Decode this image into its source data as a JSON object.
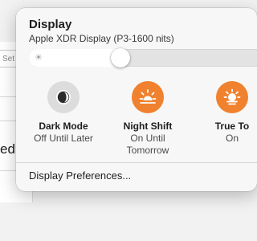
{
  "background": {
    "field_text": "Set S",
    "side_text": "ed"
  },
  "panel": {
    "title": "Display",
    "subtitle": "Apple XDR Display (P3-1600 nits)",
    "brightness": {
      "icon": "sun-icon",
      "level": 0.38
    },
    "tiles": [
      {
        "label": "Dark Mode",
        "status": "Off Until Later",
        "icon": "dark-mode-icon",
        "active": false
      },
      {
        "label": "Night Shift",
        "status": "On Until Tomorrow",
        "icon": "night-shift-icon",
        "active": true
      },
      {
        "label": "True To",
        "status": "On",
        "icon": "true-tone-icon",
        "active": true
      }
    ],
    "preferences_link": "Display Preferences..."
  },
  "colors": {
    "accent_orange": "#f0812f",
    "tile_off": "#dcdcdc",
    "panel_bg": "#f7f7f7"
  }
}
